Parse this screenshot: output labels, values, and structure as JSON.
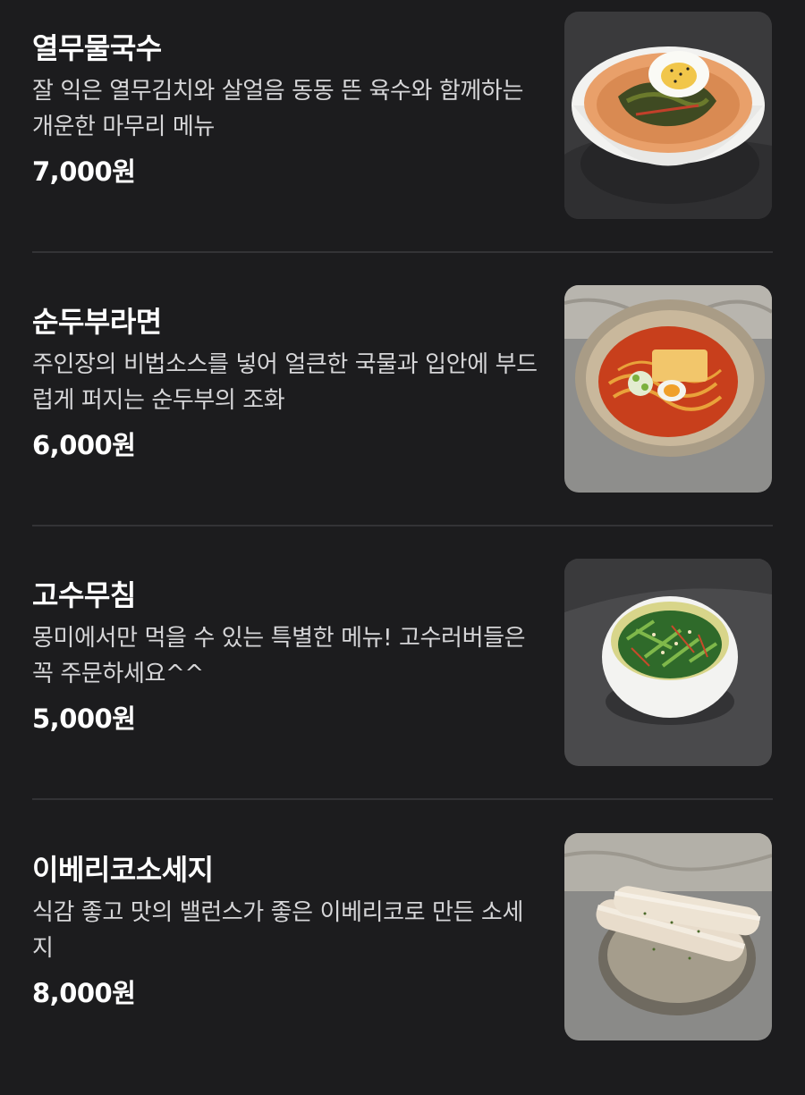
{
  "menu": {
    "items": [
      {
        "name": "열무물국수",
        "description": "잘 익은 열무김치와 살얼음 동동 뜬 육수와 함께하는 개운한 마무리 메뉴",
        "price": "7,000원",
        "photo_icon": "yeolmu-noodle-photo"
      },
      {
        "name": "순두부라면",
        "description": "주인장의 비법소스를 넣어 얼큰한 국물과 입안에 부드럽게 퍼지는 순두부의 조화",
        "price": "6,000원",
        "photo_icon": "tofu-ramen-photo"
      },
      {
        "name": "고수무침",
        "description": "몽미에서만 먹을 수 있는 특별한 메뉴! 고수러버들은 꼭 주문하세요^^",
        "price": "5,000원",
        "photo_icon": "coriander-salad-photo"
      },
      {
        "name": "이베리코소세지",
        "description": "식감 좋고 맛의 밸런스가 좋은 이베리코로 만든 소세지",
        "price": "8,000원",
        "photo_icon": "iberico-sausage-photo"
      }
    ]
  },
  "colors": {
    "background": "#1c1c1e",
    "text": "#ffffff",
    "description": "#d6d6d8",
    "divider": "#333336"
  }
}
